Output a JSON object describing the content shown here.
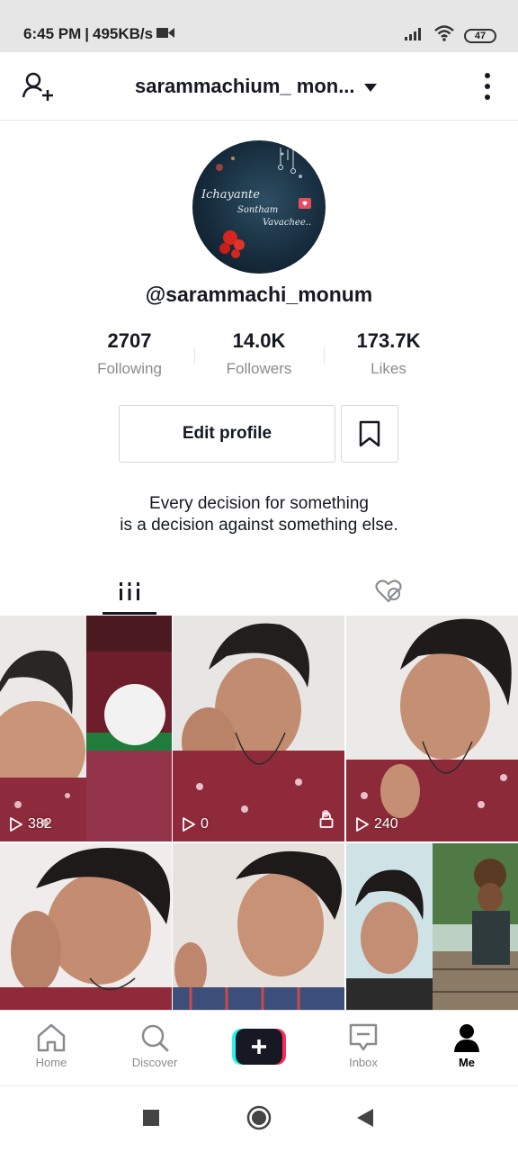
{
  "status_bar": {
    "time": "6:45 PM",
    "separator": "|",
    "network_speed": "495KB/s",
    "battery": "47"
  },
  "header": {
    "title": "sarammachium_ mon...",
    "icons": [
      "add-user-icon",
      "dropdown-caret-icon",
      "more-vertical-icon"
    ]
  },
  "profile": {
    "avatar_text": [
      "Ichayante",
      "Sontham",
      "Vavachee.."
    ],
    "username": "@sarammachi_monum",
    "stats": [
      {
        "value": "2707",
        "label": "Following"
      },
      {
        "value": "14.0K",
        "label": "Followers"
      },
      {
        "value": "173.7K",
        "label": "Likes"
      }
    ],
    "edit_button": "Edit profile",
    "bio_line1": "Every decision for something",
    "bio_line2": "is a decision against something else."
  },
  "tabs": [
    {
      "name": "videos",
      "icon": "grid-bars-icon",
      "active": true
    },
    {
      "name": "liked",
      "icon": "hidden-heart-icon",
      "active": false
    }
  ],
  "videos": [
    {
      "plays": "382",
      "locked": false
    },
    {
      "plays": "0",
      "locked": true
    },
    {
      "plays": "240",
      "locked": false
    },
    {
      "plays": null,
      "locked": false
    },
    {
      "plays": null,
      "locked": false
    },
    {
      "plays": null,
      "locked": false
    }
  ],
  "bottom_nav": [
    {
      "label": "Home",
      "icon": "home-icon"
    },
    {
      "label": "Discover",
      "icon": "search-icon"
    },
    {
      "label": "",
      "icon": "plus-icon"
    },
    {
      "label": "Inbox",
      "icon": "inbox-icon"
    },
    {
      "label": "Me",
      "icon": "profile-icon",
      "active": true
    }
  ],
  "colors": {
    "text": "#161823",
    "muted": "#8a8b91",
    "create_cyan": "#25f4ee",
    "create_red": "#fe2c55"
  }
}
